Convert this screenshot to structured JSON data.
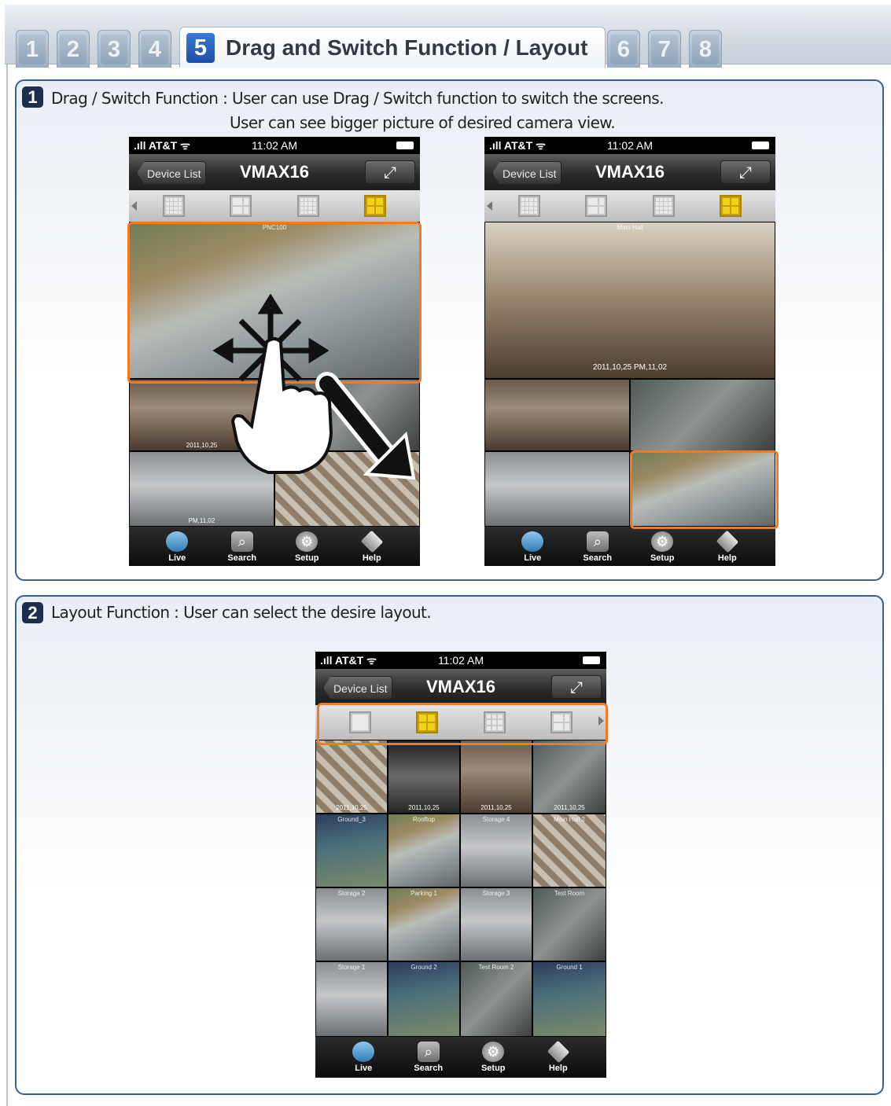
{
  "tabs": [
    {
      "num": "1"
    },
    {
      "num": "2"
    },
    {
      "num": "3"
    },
    {
      "num": "4"
    },
    {
      "num": "5",
      "title": "Drag and Switch Function / Layout"
    },
    {
      "num": "6"
    },
    {
      "num": "7"
    },
    {
      "num": "8"
    }
  ],
  "section1": {
    "badge": "1",
    "line1": "Drag / Switch Function : User can use Drag / Switch function to switch the screens.",
    "line2": "User can see bigger picture of desired camera view."
  },
  "section2": {
    "badge": "2",
    "line1": "Layout Function : User can select the desire layout."
  },
  "phone": {
    "carrier": ".ıll AT&T ᯤ",
    "time": "11:02 AM",
    "back": "Device List",
    "title": "VMAX16",
    "expand": "⤢",
    "tab_live": "Live",
    "tab_search": "Search",
    "tab_setup": "Setup",
    "tab_help": "Help"
  },
  "cams": {
    "ts_date": "2011,10,25",
    "ts_time": "PM,11,02",
    "pnc": "PNC100",
    "storage": "Storage",
    "hall": "Main Hall",
    "ground3": "Ground_3",
    "rooftop": "Rooftop",
    "storage4": "Storage 4",
    "mainhall2": "Main Hall 2",
    "storage2": "Storage 2",
    "parking1": "Parking 1",
    "storage3": "Storage 3",
    "testroom": "Test Room",
    "storage1": "Storage 1",
    "ground2": "Ground 2",
    "testroom2": "Test Room 2",
    "ground1": "Ground 1"
  }
}
